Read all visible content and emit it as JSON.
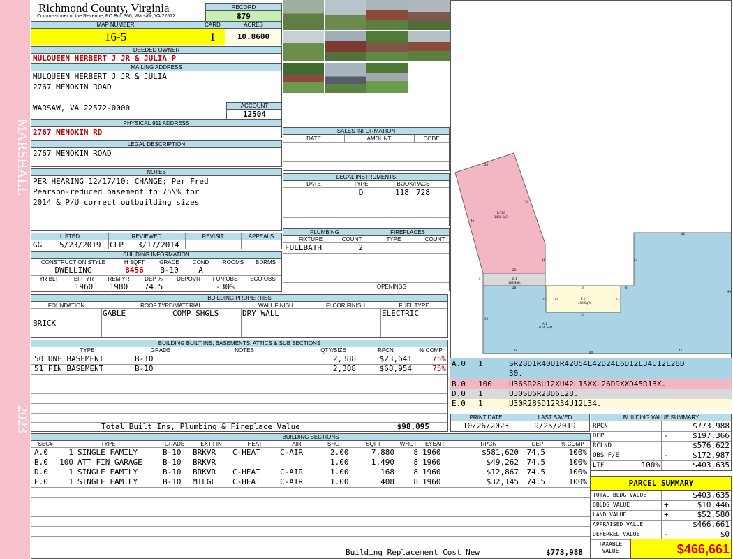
{
  "side": {
    "district": "MARSHALL",
    "year": "2023"
  },
  "header": {
    "county": "Richmond County, Virginia",
    "commissioner": "Commissioner of the Revenue, PO Box 366, Warsaw, VA 22572",
    "record_label": "RECORD",
    "record": "879",
    "map_label": "MAP NUMBER",
    "map": "16-5",
    "card_label": "CARD",
    "card": "1",
    "acres_label": "ACRES",
    "acres": "10.8600"
  },
  "owner": {
    "deeded_label": "DEEDED OWNER",
    "deeded": "MULQUEEN HERBERT J JR & JULIA P",
    "mailing_label": "MAILING ADDRESS",
    "mail1": "MULQUEEN HERBERT J JR & JULIA",
    "mail2": "2767 MENOKIN ROAD",
    "mail3": "WARSAW, VA 22572-0000",
    "account_label": "ACCOUNT",
    "account": "12504",
    "phys_label": "PHYSICAL 911 ADDRESS",
    "phys": "2767 MENOKIN RD",
    "legal_label": "LEGAL DESCRIPTION",
    "legal": "2767 MENOKIN ROAD",
    "notes_label": "NOTES",
    "notes1": "PER HEARING 12/17/10: CHANGE; Per Fred",
    "notes2": "Pearson-reduced basement to 75\\% for",
    "notes3": "2014 & P/U correct outbuilding sizes"
  },
  "status": {
    "listed_label": "LISTED",
    "listed_by": "GG",
    "listed_date": "5/23/2019",
    "reviewed_label": "REVIEWED",
    "reviewed_by": "CLP",
    "reviewed_date": "3/17/2014",
    "revisit_label": "REVISIT",
    "appeals_label": "APPEALS"
  },
  "building_info": {
    "label": "BUILDING INFORMATION",
    "h_style": "CONSTRUCTION STYLE",
    "h_sqft": "H SQFT",
    "h_grade": "GRADE",
    "h_cond": "COND",
    "h_rooms": "ROOMS",
    "h_bdrms": "BDRMS",
    "style": "DWELLING",
    "sqft": "8456",
    "grade": "B-10",
    "cond": "A",
    "h_yrblt": "YR BLT",
    "h_effyr": "EFF YR",
    "h_remyr": "REM YR",
    "h_dep": "DEP %",
    "h_depovr": "DEPOVR",
    "h_funobs": "FUN OBS",
    "h_ecoobs": "ECO OBS",
    "effyr": "1960",
    "remyr": "1980",
    "dep": "74.5",
    "funobs": "-30%"
  },
  "properties": {
    "label": "BUILDING PROPERTIES",
    "h_found": "FOUNDATION",
    "h_roof": "ROOF TYPE/MATERIAL",
    "h_wall": "WALL FINISH",
    "h_floor": "FLOOR FINISH",
    "h_fuel": "FUEL TYPE",
    "foundation": "BRICK",
    "roof_type": "GABLE",
    "roof_mat": "COMP SHGLS",
    "wall": "DRY WALL",
    "fuel": "ELECTRIC"
  },
  "builtins": {
    "label": "BUILDING BUILT INS, BASEMENTS, ATTICS & SUB SECTIONS",
    "h_type": "TYPE",
    "h_grade": "GRADE",
    "h_notes": "NOTES",
    "h_qty": "QTY/SIZE",
    "h_rpcn": "RPCN",
    "h_comp": "% COMP",
    "rows": [
      {
        "type": "50 UNF BASEMENT",
        "grade": "B-10",
        "qty": "2,388",
        "rpcn": "$23,641",
        "comp": "75%"
      },
      {
        "type": "51 FIN BASEMENT",
        "grade": "B-10",
        "qty": "2,388",
        "rpcn": "$68,954",
        "comp": "75%"
      }
    ],
    "total_label": "Total Built Ins, Plumbing & Fireplace Value",
    "total": "$98,095"
  },
  "sections": {
    "label": "BUILDING SECTIONS",
    "h_sec": "SEC#",
    "h_type": "TYPE",
    "h_grade": "GRADE",
    "h_extfin": "EXT FIN",
    "h_heat": "HEAT",
    "h_air": "AIR",
    "h_shgt": "SHGT",
    "h_sqft": "SQFT",
    "h_whgt": "WHGT",
    "h_eyear": "EYEAR",
    "h_rpcn": "RPCN",
    "h_dep": "DEP",
    "h_comp": "% COMP",
    "rows": [
      {
        "sec": "A.0",
        "qty": "1",
        "type": "SINGLE FAMILY",
        "grade": "B-10",
        "ext": "BRKVR",
        "heat": "C-HEAT",
        "air": "C-AIR",
        "shgt": "2.00",
        "sqft": "7,880",
        "whgt": "8",
        "eyear": "1960",
        "rpcn": "$581,620",
        "dep": "74.5",
        "comp": "100%"
      },
      {
        "sec": "B.0",
        "qty": "100",
        "type": "ATT FIN GARAGE",
        "grade": "B-10",
        "ext": "BRKVR",
        "heat": "",
        "air": "",
        "shgt": "1.00",
        "sqft": "1,490",
        "whgt": "8",
        "eyear": "1960",
        "rpcn": "$49,262",
        "dep": "74.5",
        "comp": "100%"
      },
      {
        "sec": "D.0",
        "qty": "1",
        "type": "SINGLE FAMILY",
        "grade": "B-10",
        "ext": "BRKVR",
        "heat": "C-HEAT",
        "air": "C-AIR",
        "shgt": "1.00",
        "sqft": "168",
        "whgt": "8",
        "eyear": "1960",
        "rpcn": "$12,867",
        "dep": "74.5",
        "comp": "100%"
      },
      {
        "sec": "E.0",
        "qty": "1",
        "type": "SINGLE FAMILY",
        "grade": "B-10",
        "ext": "MTLGL",
        "heat": "C-HEAT",
        "air": "C-AIR",
        "shgt": "1.00",
        "sqft": "408",
        "whgt": "8",
        "eyear": "1960",
        "rpcn": "$32,145",
        "dep": "74.5",
        "comp": "100%"
      }
    ],
    "total_label": "Building Replacement Cost New",
    "total": "$773,988"
  },
  "sales": {
    "label": "SALES INFORMATION",
    "h_date": "DATE",
    "h_amount": "AMOUNT",
    "h_code": "CODE"
  },
  "legal_inst": {
    "label": "LEGAL INSTRUMENTS",
    "h_date": "DATE",
    "h_type": "TYPE",
    "h_book": "BOOK/PAGE",
    "type": "D",
    "book": "118",
    "page": "728"
  },
  "plumbing": {
    "label": "PLUMBING",
    "h_fixture": "FIXTURE",
    "h_count": "COUNT",
    "fixture": "FULLBATH",
    "count": "2"
  },
  "fireplaces": {
    "label": "FIREPLACES",
    "h_type": "TYPE",
    "h_count": "COUNT",
    "openings": "OPENINGS"
  },
  "sketch": {
    "a_label": "A.1",
    "a_area": "3166 SqFt",
    "b_label": "B.100",
    "b_area": "1490 SqFt",
    "d_label": "D.1",
    "d_area": "168 SqFt",
    "e_label": "E.1",
    "e_area": "408 SqFt",
    "dims": {
      "top_right": "42",
      "right": "96",
      "left": "30",
      "bottom_a": "28",
      "bottom_b": "40",
      "bottom_c": "42",
      "garage_top": "28",
      "garage_left": "46",
      "garage_right": "54",
      "garage_bottom": "12",
      "garage_mid": "28",
      "d_dim": "28",
      "d_dim2": "6",
      "e_left": "12",
      "e_right": "12",
      "e_top": "34",
      "e_bottom": "34",
      "mid_right": "24",
      "mid_left": "12",
      "mid_c": "6"
    },
    "colors": {
      "a": "#a8d4e6",
      "b": "#f4b6c2",
      "d": "#d9d9d9",
      "e": "#fffad9"
    }
  },
  "vectors": [
    {
      "sec": "A.0",
      "qty": "1",
      "code": "SR28D1R40U1R42U54L42D24L6D12L34U12L28D",
      "code2": "30."
    },
    {
      "sec": "B.0",
      "qty": "100",
      "code": "U36SR28U12XU42L15XXL26D9XXD45R13X."
    },
    {
      "sec": "D.0",
      "qty": "1",
      "code": "U30SU6R28D6L28."
    },
    {
      "sec": "E.0",
      "qty": "1",
      "code": "U30R28SD12R34U12L34."
    }
  ],
  "print": {
    "print_label": "PRINT DATE",
    "print_date": "10/26/2023",
    "saved_label": "LAST SAVED",
    "saved_date": "9/25/2019"
  },
  "value_summary": {
    "label": "BUILDING VALUE SUMMARY",
    "rpcn_label": "RPCN",
    "rpcn": "$773,988",
    "dep_label": "DEP",
    "dep_sign": "-",
    "dep": "$197,366",
    "rclnd_label": "RCLND",
    "rclnd": "$576,622",
    "obs_label": "OBS F/E",
    "obs_sign": "-",
    "obs": "$172,987",
    "ltf_label": "LTF",
    "ltf_pct": "100%",
    "ltf": "$403,635"
  },
  "parcel": {
    "label": "PARCEL SUMMARY",
    "tbv_label": "TOTAL BLDG VALUE",
    "tbv": "$403,635",
    "obv_label": "OBLDG VALUE",
    "obv_sign": "+",
    "obv": "$10,446",
    "land_label": "LAND VALUE",
    "land_sign": "+",
    "land": "$52,580",
    "appr_label": "APPRAISED VALUE",
    "appr": "$466,661",
    "def_label": "DEFERRED VALUE",
    "def_sign": "-",
    "def": "$0",
    "tax_label1": "TAXABLE",
    "tax_label2": "VALUE",
    "taxable": "$466,661"
  }
}
